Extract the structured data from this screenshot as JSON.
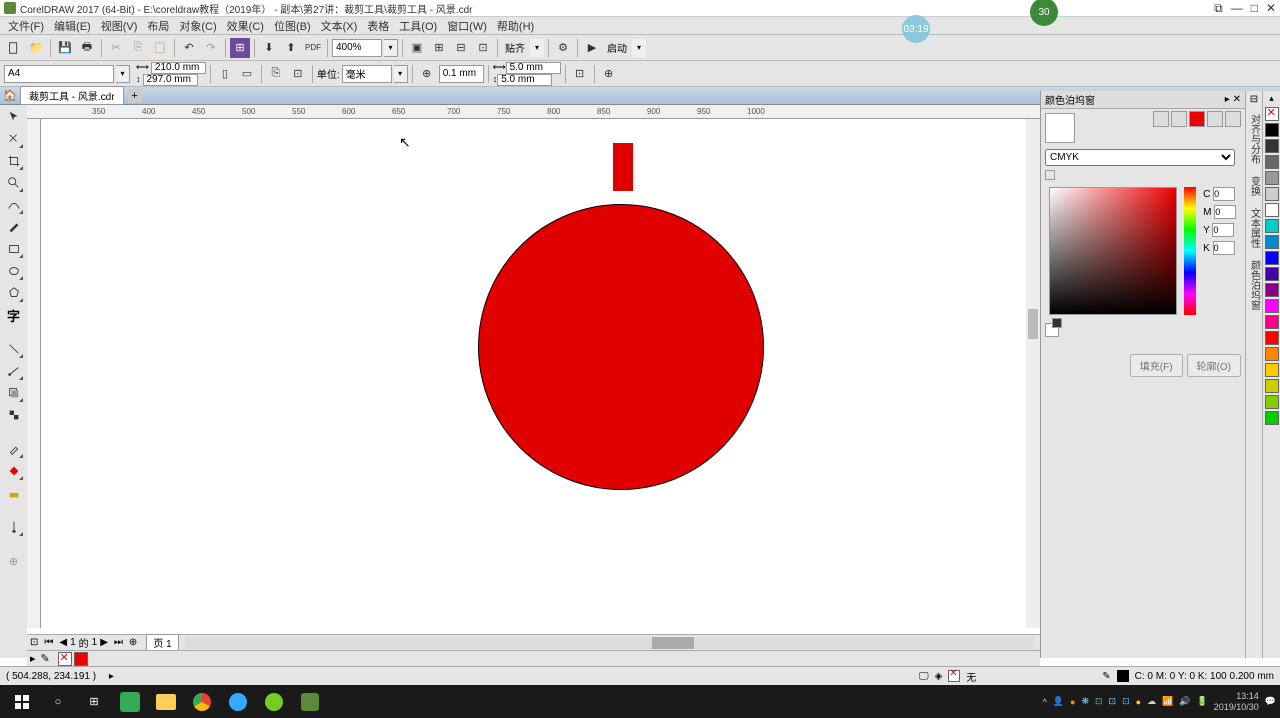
{
  "title": "CorelDRAW 2017 (64-Bit) - E:\\coreldraw教程（2019年） - 副本\\第27讲：裁剪工具\\裁剪工具 - 风景.cdr",
  "menu": [
    "文件(F)",
    "编辑(E)",
    "视图(V)",
    "布局",
    "对象(C)",
    "效果(C)",
    "位图(B)",
    "文本(X)",
    "表格",
    "工具(O)",
    "窗口(W)",
    "帮助(H)"
  ],
  "toolbar1": {
    "zoom": "400%",
    "pdf": "PDF",
    "launch": "贴齐",
    "options": "启动"
  },
  "toolbar2": {
    "paper": "A4",
    "w": "210.0 mm",
    "h": "297.0 mm",
    "unit_label": "单位:",
    "unit": "毫米",
    "nudge": "0.1 mm",
    "dx": "5.0 mm",
    "dy": "5.0 mm"
  },
  "tab": {
    "name": "裁剪工具 - 风景.cdr"
  },
  "ruler_ticks": [
    "350",
    "400",
    "450",
    "500",
    "550",
    "600",
    "650",
    "700",
    "750",
    "800",
    "850",
    "900",
    "950",
    "1000"
  ],
  "colorpanel": {
    "title": "颜色泊坞窗",
    "mode": "CMYK",
    "c": "0",
    "m": "0",
    "y": "0",
    "k": "0",
    "fill": "填充(F)",
    "outline": "轮廓(O)"
  },
  "right_tabs": [
    "对齐与分布",
    "变换",
    "文本属性",
    "颜色泊坞窗"
  ],
  "palette": [
    "#000",
    "#333",
    "#666",
    "#999",
    "#ccc",
    "#fff",
    "#8B4513",
    "#ff8800",
    "#f00",
    "#f0f",
    "#808",
    "#00f",
    "#0cc",
    "#0c0",
    "#8c0",
    "#cc0",
    "#c80",
    "#840"
  ],
  "page": {
    "cur": "1",
    "of": "的",
    "total": "1",
    "label": "页 1"
  },
  "status": {
    "coords": "( 504.288, 234.191 )",
    "none": "无",
    "info": "C: 0 M: 0 Y: 0 K: 100  0.200 mm"
  },
  "clock": {
    "time": "13:14",
    "date": "2019/10/30"
  },
  "badges": {
    "green": "30",
    "blue": "03:19"
  }
}
